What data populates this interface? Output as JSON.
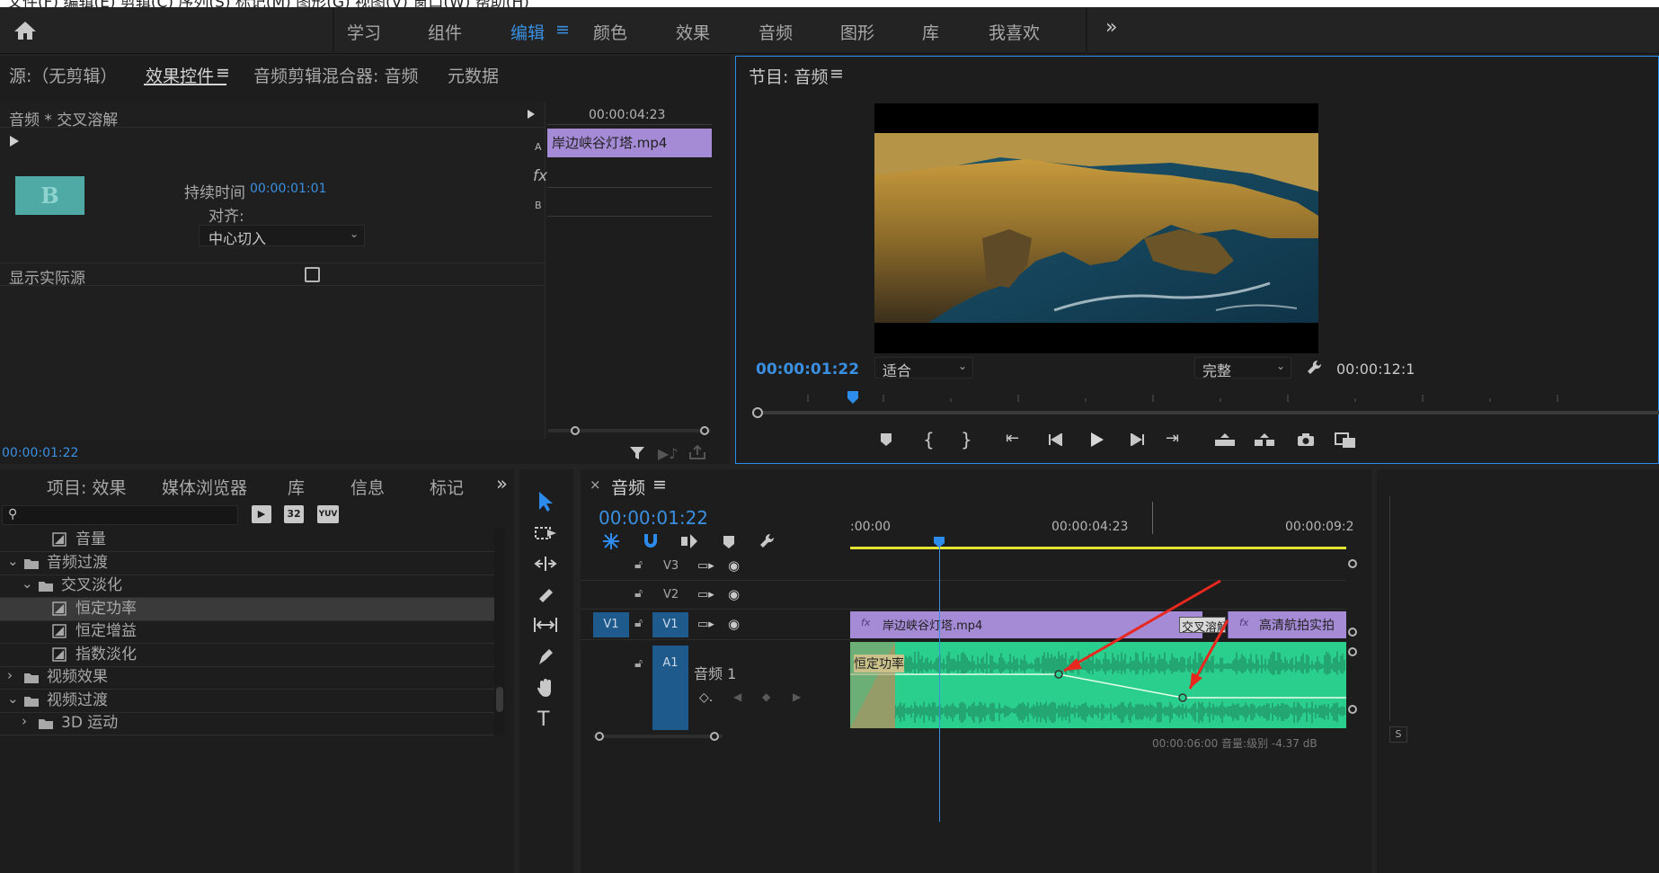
{
  "topbar": {
    "partial_text": "文件(F)  编辑(E)  剪辑(C)  序列(S)  标记(M)  图形(G)  视图(V)  窗口(W)  帮助(H)",
    "tabs": [
      "学习",
      "组件",
      "编辑",
      "颜色",
      "效果",
      "音频",
      "图形",
      "库",
      "我喜欢"
    ],
    "active_tab": "编辑",
    "overflow": "»"
  },
  "effect_controls": {
    "tabs": [
      "源:（无剪辑）",
      "效果控件",
      "音频剪辑混合器: 音频",
      "元数据"
    ],
    "clip_title": "音频 * 交叉溶解",
    "duration_label": "持续时间",
    "duration_value": "00:00:01:01",
    "align_label": "对齐:",
    "align_value": "中心切入",
    "show_source_label": "显示实际源",
    "thumb_letter": "B",
    "mini_timecode": "00:00:04:23",
    "mini_clip": "岸边峡谷灯塔.mp4",
    "label_a": "A",
    "label_fx": "fx",
    "label_b": "B",
    "bottom_timecode": "00:00:01:22"
  },
  "program": {
    "title": "节目: 音频",
    "timecode": "00:00:01:22",
    "fit_value": "适合",
    "quality_value": "完整",
    "end_timecode": "00:00:12:1"
  },
  "project": {
    "tabs": [
      "项目: 效果",
      "媒体浏览器",
      "库",
      "信息",
      "标记"
    ],
    "badges": [
      "32",
      "YUV"
    ],
    "tree": [
      {
        "label": "音量",
        "level": 2,
        "type": "item",
        "expand": ""
      },
      {
        "label": "音频过渡",
        "level": 0,
        "type": "folder",
        "expand": "⌄"
      },
      {
        "label": "交叉淡化",
        "level": 1,
        "type": "folder",
        "expand": "⌄"
      },
      {
        "label": "恒定功率",
        "level": 2,
        "type": "item",
        "expand": "",
        "selected": true
      },
      {
        "label": "恒定增益",
        "level": 2,
        "type": "item",
        "expand": ""
      },
      {
        "label": "指数淡化",
        "level": 2,
        "type": "item",
        "expand": ""
      },
      {
        "label": "视频效果",
        "level": 0,
        "type": "folder",
        "expand": "›"
      },
      {
        "label": "视频过渡",
        "level": 0,
        "type": "folder",
        "expand": "⌄"
      },
      {
        "label": "3D 运动",
        "level": 1,
        "type": "folder",
        "expand": "›"
      }
    ]
  },
  "timeline": {
    "title": "音频",
    "timecode": "00:00:01:22",
    "ruler": [
      ":00:00",
      "00:00:04:23",
      "00:00:09:2"
    ],
    "tracks": [
      "V3",
      "V2",
      "V1",
      "A1"
    ],
    "v1_source": "V1",
    "clip1": "岸边峡谷灯塔.mp4",
    "transition": "交叉溶解",
    "clip2": "高清航拍实拍",
    "audio_track_name": "音频 1",
    "audio_transition": "恒定功率",
    "fx_badge": "fx",
    "status_text": "00:00:06:00  音量:级别  -4.37 dB"
  },
  "colors": {
    "accent": "#2d8ceb",
    "video_clip": "#a58ad6",
    "audio_clip": "#2bcf8d",
    "playhead": "#3a8fe0",
    "thumb": "#4fa9a4"
  }
}
